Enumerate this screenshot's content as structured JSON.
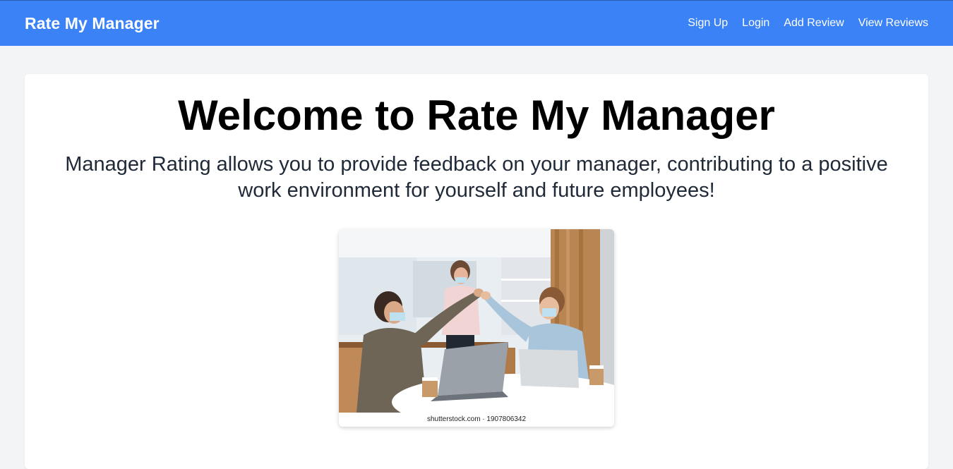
{
  "nav": {
    "brand": "Rate My Manager",
    "links": [
      {
        "label": "Sign Up"
      },
      {
        "label": "Login"
      },
      {
        "label": "Add Review"
      },
      {
        "label": "View Reviews"
      }
    ]
  },
  "hero": {
    "title": "Welcome to Rate My Manager",
    "subtitle": "Manager Rating allows you to provide feedback on your manager, contributing to a positive work environment for yourself and future employees!"
  },
  "image": {
    "caption": "shutterstock.com · 1907806342"
  },
  "colors": {
    "navbar": "#3b82f6",
    "page_background": "#f3f4f6",
    "card_background": "#ffffff"
  }
}
